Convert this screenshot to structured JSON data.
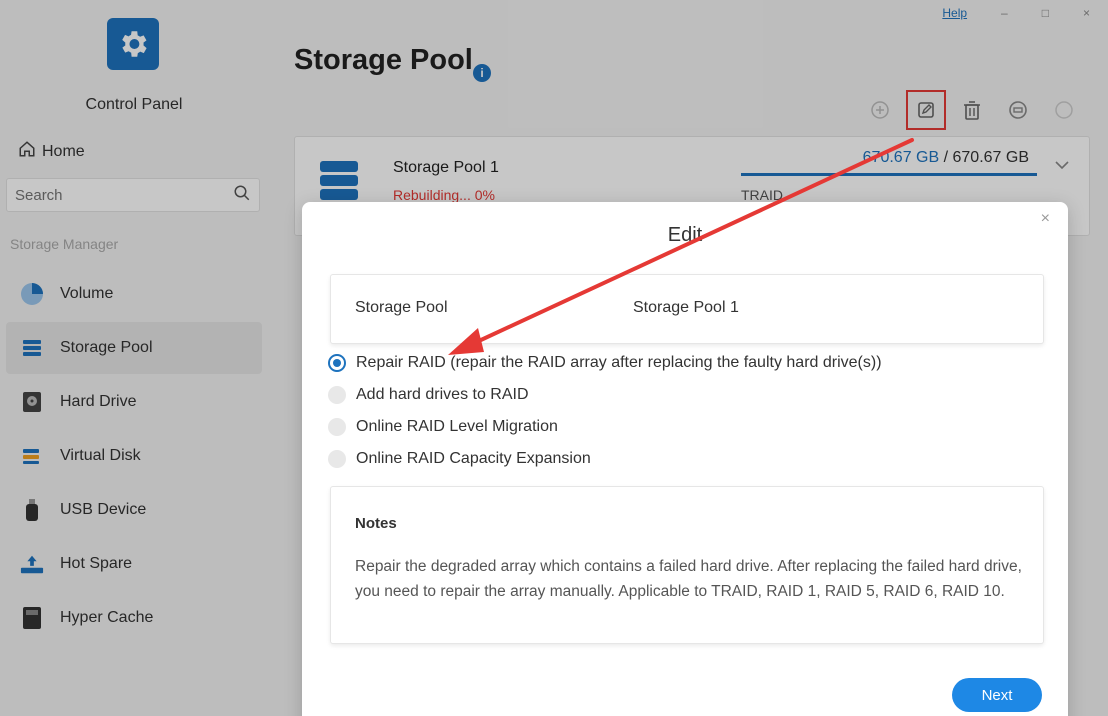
{
  "window": {
    "help_label": "Help",
    "minimize": "–",
    "maximize": "□",
    "close": "×"
  },
  "sidebar": {
    "app_title": "Control Panel",
    "home_label": "Home",
    "search_placeholder": "Search",
    "section_label": "Storage Manager",
    "items": [
      {
        "label": "Volume",
        "icon": "volume-icon"
      },
      {
        "label": "Storage Pool",
        "icon": "storage-pool-icon",
        "active": true
      },
      {
        "label": "Hard Drive",
        "icon": "hard-drive-icon"
      },
      {
        "label": "Virtual Disk",
        "icon": "virtual-disk-icon"
      },
      {
        "label": "USB Device",
        "icon": "usb-device-icon"
      },
      {
        "label": "Hot Spare",
        "icon": "hot-spare-icon"
      },
      {
        "label": "Hyper Cache",
        "icon": "hyper-cache-icon"
      }
    ]
  },
  "main": {
    "title": "Storage Pool",
    "pool": {
      "name": "Storage Pool 1",
      "status": "Rebuilding... 0%",
      "capacity_used": "670.67 GB",
      "capacity_sep": " / ",
      "capacity_total": "670.67 GB",
      "raid": "TRAID"
    }
  },
  "modal": {
    "title": "Edit",
    "close": "×",
    "info_label": "Storage Pool",
    "info_value": "Storage Pool 1",
    "options": [
      {
        "label": "Repair RAID (repair the RAID array after replacing the faulty hard drive(s))",
        "checked": true
      },
      {
        "label": "Add hard drives to RAID",
        "checked": false
      },
      {
        "label": "Online RAID Level Migration",
        "checked": false
      },
      {
        "label": "Online RAID Capacity Expansion",
        "checked": false
      }
    ],
    "notes_title": "Notes",
    "notes_text": "Repair the degraded array which contains a failed hard drive. After replacing the failed hard drive, you need to repair the array manually. Applicable to TRAID, RAID 1, RAID 5, RAID 6, RAID 10.",
    "next_label": "Next"
  },
  "colors": {
    "accent": "#1e73be",
    "button": "#1e88e5",
    "error": "#e53935",
    "annotation": "#e53935"
  }
}
